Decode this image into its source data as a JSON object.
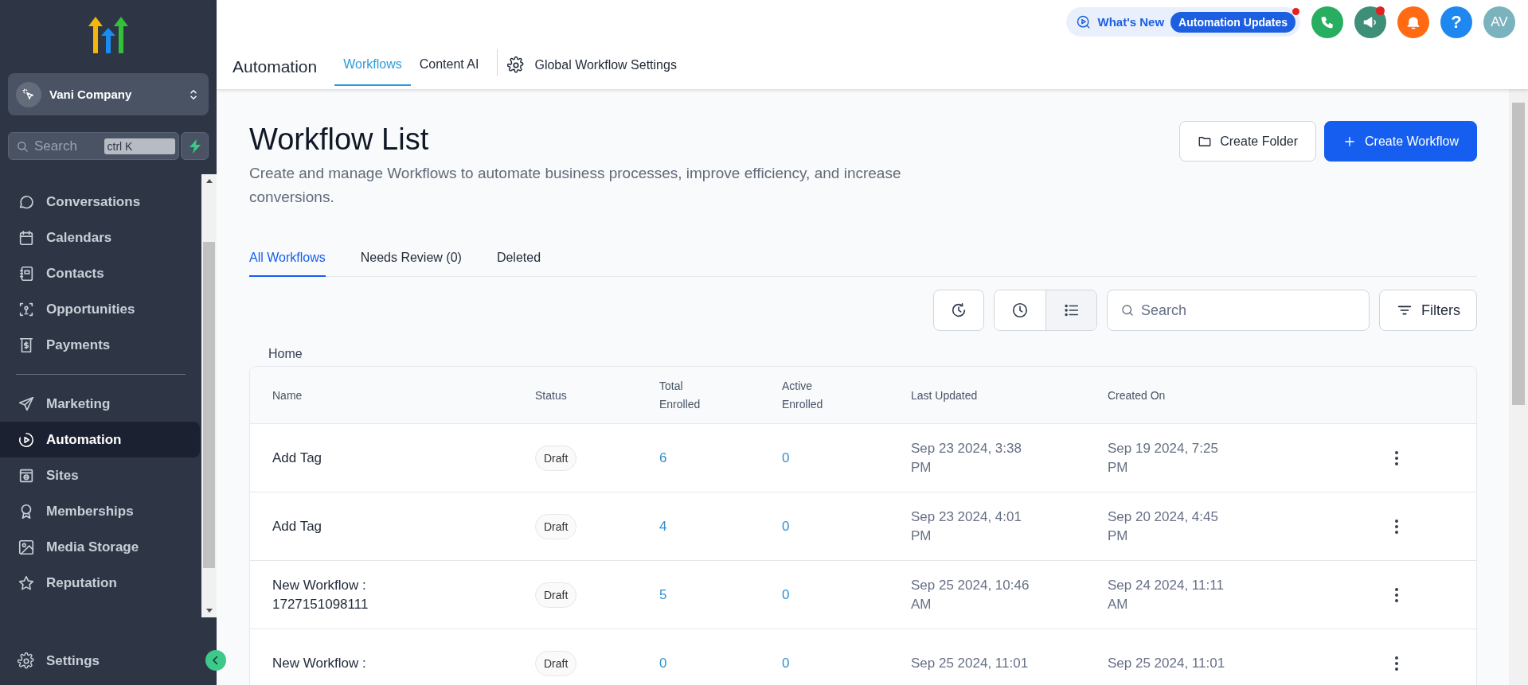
{
  "sidebar": {
    "company": "Vani Company",
    "search": {
      "placeholder": "Search",
      "shortcut": "ctrl K"
    },
    "nav_groups": [
      [
        {
          "label": "Conversations",
          "selected": false
        },
        {
          "label": "Calendars",
          "selected": false
        },
        {
          "label": "Contacts",
          "selected": false
        },
        {
          "label": "Opportunities",
          "selected": false
        },
        {
          "label": "Payments",
          "selected": false
        }
      ],
      [
        {
          "label": "Marketing",
          "selected": false
        },
        {
          "label": "Automation",
          "selected": true
        },
        {
          "label": "Sites",
          "selected": false
        },
        {
          "label": "Memberships",
          "selected": false
        },
        {
          "label": "Media Storage",
          "selected": false
        },
        {
          "label": "Reputation",
          "selected": false
        }
      ]
    ],
    "footer_item": {
      "label": "Settings"
    }
  },
  "header": {
    "whats_new": "What's New",
    "updates_badge": {
      "label": "Automation Updates",
      "unread": true
    },
    "actions": [
      {
        "kind": "phone",
        "unread": false
      },
      {
        "kind": "megaphone",
        "unread": true
      },
      {
        "kind": "bell",
        "unread": false
      },
      {
        "kind": "help",
        "label": "?",
        "unread": false
      }
    ],
    "avatar": "AV",
    "title": "Automation",
    "tabs": [
      {
        "label": "Workflows",
        "selected": true
      },
      {
        "label": "Content AI",
        "selected": false
      }
    ],
    "settings_link": "Global Workflow Settings"
  },
  "page": {
    "title": "Workflow List",
    "description": "Create and manage Workflows to automate business processes, improve efficiency, and increase conversions.",
    "buttons": [
      {
        "kind": "secondary",
        "label": "Create Folder"
      },
      {
        "kind": "primary",
        "label": "Create Workflow"
      }
    ],
    "tabs": [
      {
        "label": "All Workflows",
        "selected": true
      },
      {
        "label": "Needs Review (0)",
        "selected": false
      },
      {
        "label": "Deleted",
        "selected": false
      }
    ],
    "toolbar": {
      "views": [
        {
          "kind": "clock",
          "selected": false
        },
        {
          "kind": "list",
          "selected": true
        }
      ],
      "search": {
        "placeholder": "Search"
      },
      "filters": "Filters"
    },
    "breadcrumb": "Home",
    "table": {
      "columns": [
        "Name",
        "Status",
        "Total Enrolled",
        "Active Enrolled",
        "Last Updated",
        "Created On"
      ],
      "rows": [
        {
          "name": "Add Tag",
          "status": "Draft",
          "total_enrolled": "6",
          "active_enrolled": "0",
          "last_updated": "Sep 23 2024, 3:38 PM",
          "created_on": "Sep 19 2024, 7:25 PM"
        },
        {
          "name": "Add Tag",
          "status": "Draft",
          "total_enrolled": "4",
          "active_enrolled": "0",
          "last_updated": "Sep 23 2024, 4:01 PM",
          "created_on": "Sep 20 2024, 4:45 PM"
        },
        {
          "name": "New Workflow : 1727151098111",
          "status": "Draft",
          "total_enrolled": "5",
          "active_enrolled": "0",
          "last_updated": "Sep 25 2024, 10:46 AM",
          "created_on": "Sep 24 2024, 11:11 AM"
        },
        {
          "name": "New Workflow :",
          "status": "Draft",
          "total_enrolled": "0",
          "active_enrolled": "0",
          "last_updated": "Sep 25 2024, 11:01",
          "created_on": "Sep 25 2024, 11:01"
        }
      ]
    }
  }
}
